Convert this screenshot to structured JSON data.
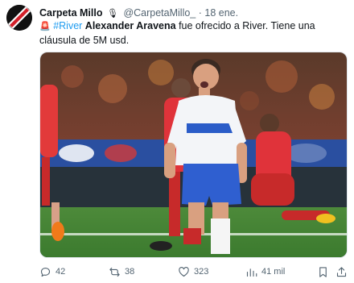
{
  "tweet": {
    "author_name": "Carpeta Millo",
    "author_badge": "🎙",
    "handle": "@CarpetaMillo_",
    "separator": "·",
    "date": "18 ene.",
    "alarm_emoji": "🚨",
    "hashtag": "#River",
    "player_name": "Alexander Aravena",
    "text_rest": " fue ofrecido a River. Tiene una cláusula de 5M usd."
  },
  "stats": {
    "replies": "42",
    "retweets": "38",
    "likes": "323",
    "views": "41 mil"
  },
  "icons": {
    "reply": "reply-icon",
    "retweet": "retweet-icon",
    "like": "heart-icon",
    "views": "views-icon",
    "bookmark": "bookmark-icon",
    "share": "share-icon"
  },
  "colors": {
    "link": "#1d9bf0",
    "text": "#0f1419",
    "muted": "#536471"
  }
}
